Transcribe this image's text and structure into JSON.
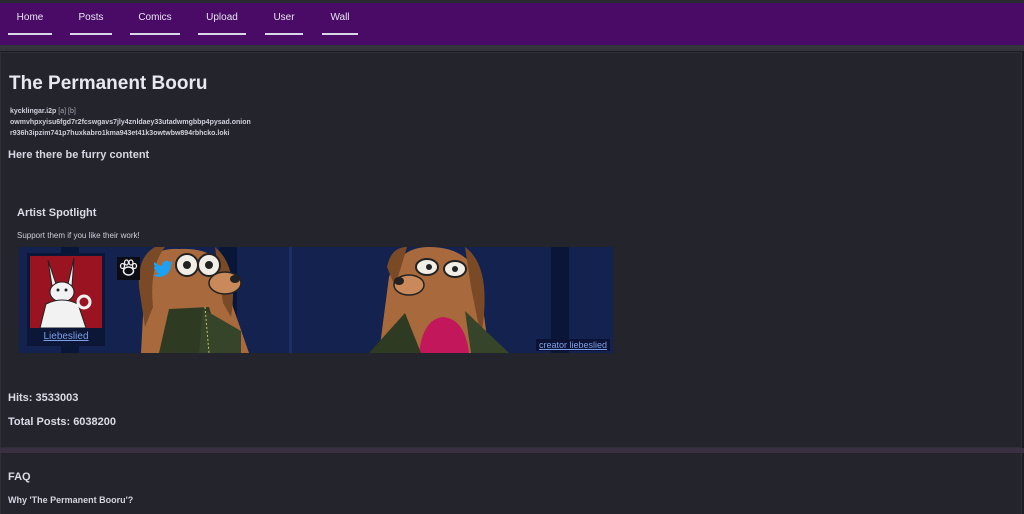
{
  "nav": {
    "items": [
      {
        "label": "Home"
      },
      {
        "label": "Posts"
      },
      {
        "label": "Comics"
      },
      {
        "label": "Upload"
      },
      {
        "label": "User"
      },
      {
        "label": "Wall"
      }
    ]
  },
  "header": {
    "title": "The Permanent Booru",
    "mirrors": [
      {
        "host": "kycklingar.i2p",
        "tags": "[a] [b]"
      },
      {
        "host": "owmvhpxyisu6fgd7r2fcswgavs7jly4znldaey33utadwmgbbp4pysad.onion",
        "tags": ""
      },
      {
        "host": "r936h3ipzim741p7huxkabro1kma943et41k3owtwbw894rbhcko.loki",
        "tags": ""
      }
    ],
    "tagline": "Here there be furry content"
  },
  "spotlight": {
    "title": "Artist Spotlight",
    "subtitle": "Support them if you like their work!",
    "artist_name": "Liebeslied",
    "credit": "creator liebeslied",
    "icons": [
      "paw-icon",
      "twitter-bird-icon"
    ]
  },
  "stats": {
    "hits": "Hits: 3533003",
    "total_posts": "Total Posts: 6038200"
  },
  "faq": {
    "title": "FAQ",
    "question1": "Why 'The Permanent Booru'?"
  },
  "colors": {
    "nav_bg": "#4a0b66",
    "page_bg": "#1b1b21",
    "panel_bg": "#24242c",
    "link": "#7fa0e6",
    "banner_bg": "#13224f"
  }
}
